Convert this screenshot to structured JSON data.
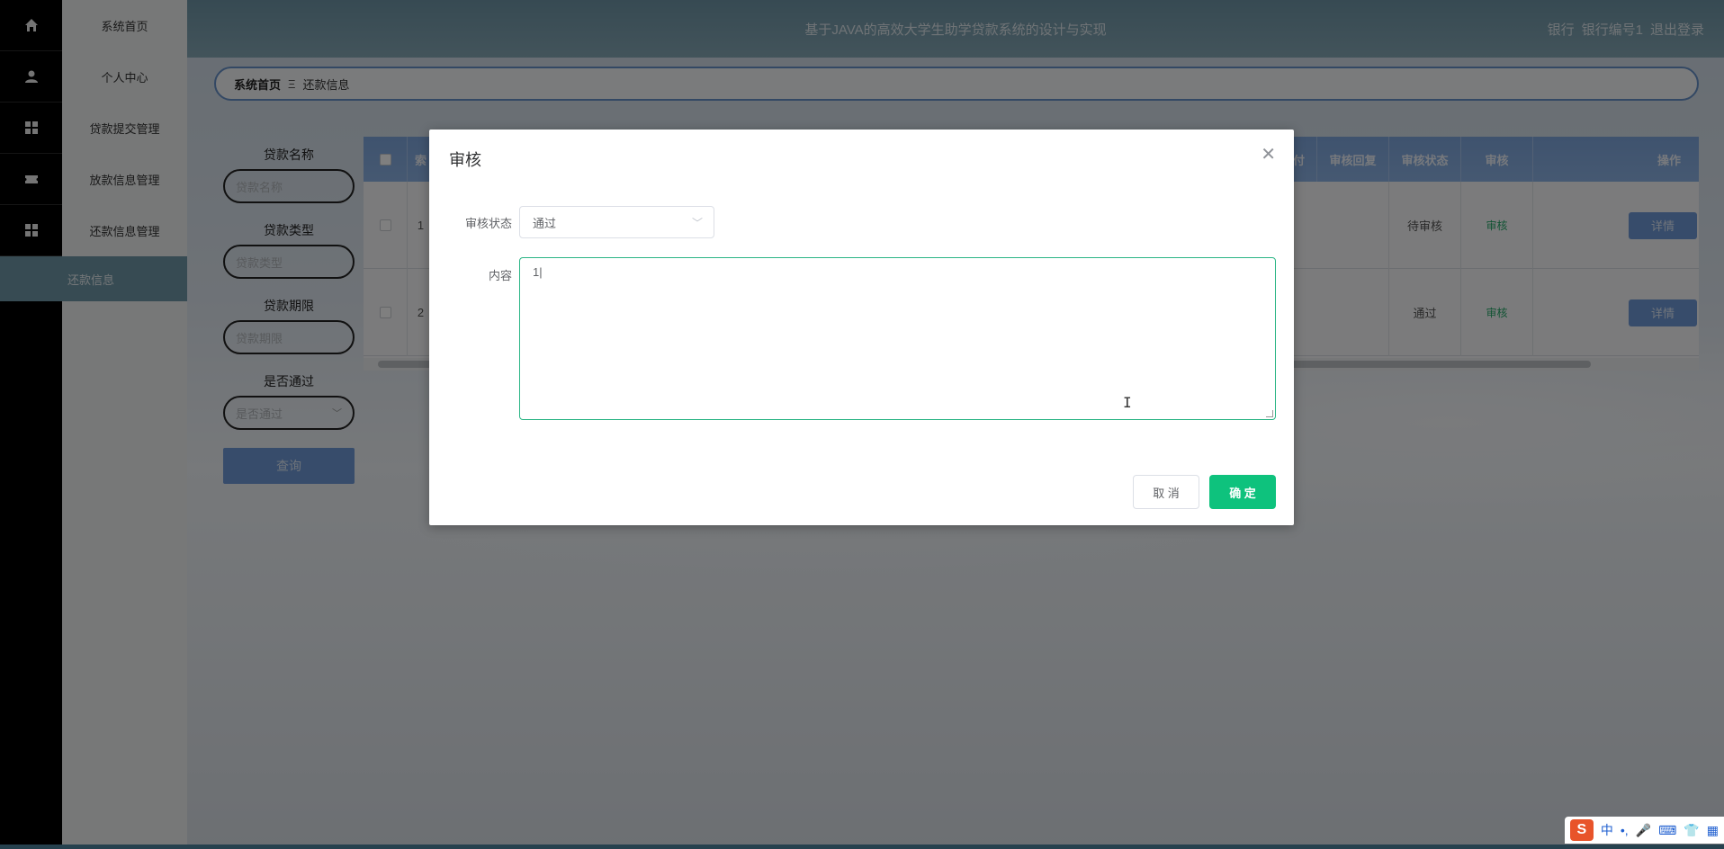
{
  "sidebar": {
    "items": [
      {
        "label": "系统首页",
        "icon": "home-icon"
      },
      {
        "label": "个人中心",
        "icon": "user-icon"
      },
      {
        "label": "贷款提交管理",
        "icon": "grid-icon"
      },
      {
        "label": "放款信息管理",
        "icon": "ticket-icon"
      },
      {
        "label": "还款信息管理",
        "icon": "grid-icon"
      }
    ],
    "active_sub": "还款信息"
  },
  "header": {
    "title": "基于JAVA的高效大学生助学贷款系统的设计与实现",
    "role": "银行",
    "user": "银行编号1",
    "logout": "退出登录"
  },
  "breadcrumb": {
    "home": "系统首页",
    "separator": "Ξ",
    "current": "还款信息"
  },
  "search": {
    "fields": [
      {
        "label": "贷款名称",
        "placeholder": "贷款名称"
      },
      {
        "label": "贷款类型",
        "placeholder": "贷款类型"
      },
      {
        "label": "贷款期限",
        "placeholder": "贷款期限"
      },
      {
        "label": "是否通过",
        "placeholder": "是否通过"
      }
    ],
    "button": "查询"
  },
  "table": {
    "headers": [
      "索",
      "付",
      "审核回复",
      "审核状态",
      "审核",
      "操作"
    ],
    "rows": [
      {
        "index": "1",
        "reply": "",
        "status": "待审核",
        "audit": "审核",
        "detail": "详情"
      },
      {
        "index": "2",
        "reply": "",
        "status": "通过",
        "audit": "审核",
        "detail": "详情"
      }
    ]
  },
  "dialog": {
    "title": "审核",
    "status_label": "审核状态",
    "status_value": "通过",
    "content_label": "内容",
    "content_value": "1",
    "cancel": "取 消",
    "confirm": "确 定"
  },
  "ime": {
    "logo": "S",
    "lang": "中",
    "punct": "•,"
  },
  "colors": {
    "accent": "#0ec27d",
    "header": "#7a9eae",
    "table_header": "#86aee2"
  }
}
